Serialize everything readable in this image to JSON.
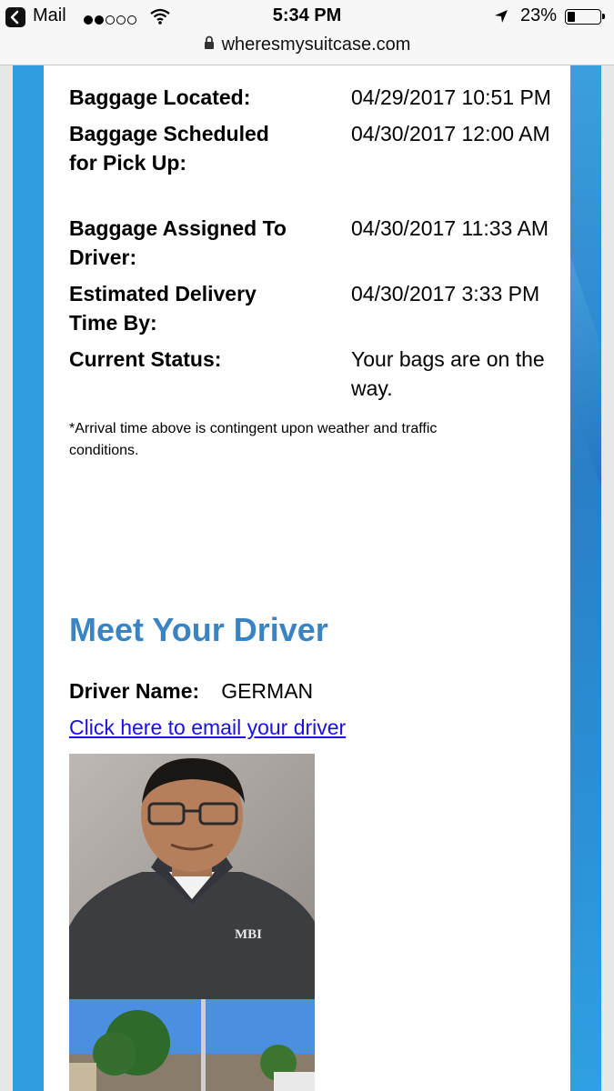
{
  "status_bar": {
    "back_app": "Mail",
    "signal_dots": [
      true,
      true,
      false,
      false,
      false
    ],
    "time": "5:34 PM",
    "battery": "23%",
    "battery_level": 0.23
  },
  "browser": {
    "url": "wheresmysuitcase.com"
  },
  "tracking": {
    "rows": [
      {
        "label": "Baggage Located:",
        "value": "04/29/2017 10:51 PM"
      },
      {
        "label": "Baggage Scheduled for Pick Up:",
        "value": "04/30/2017 12:00 AM"
      },
      {
        "label": "Baggage Assigned To Driver:",
        "value": "04/30/2017 11:33 AM"
      },
      {
        "label": "Estimated Delivery Time By:",
        "value": "04/30/2017 3:33 PM"
      },
      {
        "label": "Current Status:",
        "value": "Your bags are on the way."
      }
    ],
    "note": "*Arrival time above is contingent upon weather and traffic conditions."
  },
  "driver": {
    "section_title": "Meet Your Driver",
    "name_label": "Driver Name:",
    "name": "GERMAN",
    "email_link": "Click here to email your driver",
    "shirt_logo": "MBI"
  },
  "colors": {
    "accent_blue": "#3a84c4",
    "link": "#1a10e6",
    "side_blue": "#2f9ee0"
  }
}
